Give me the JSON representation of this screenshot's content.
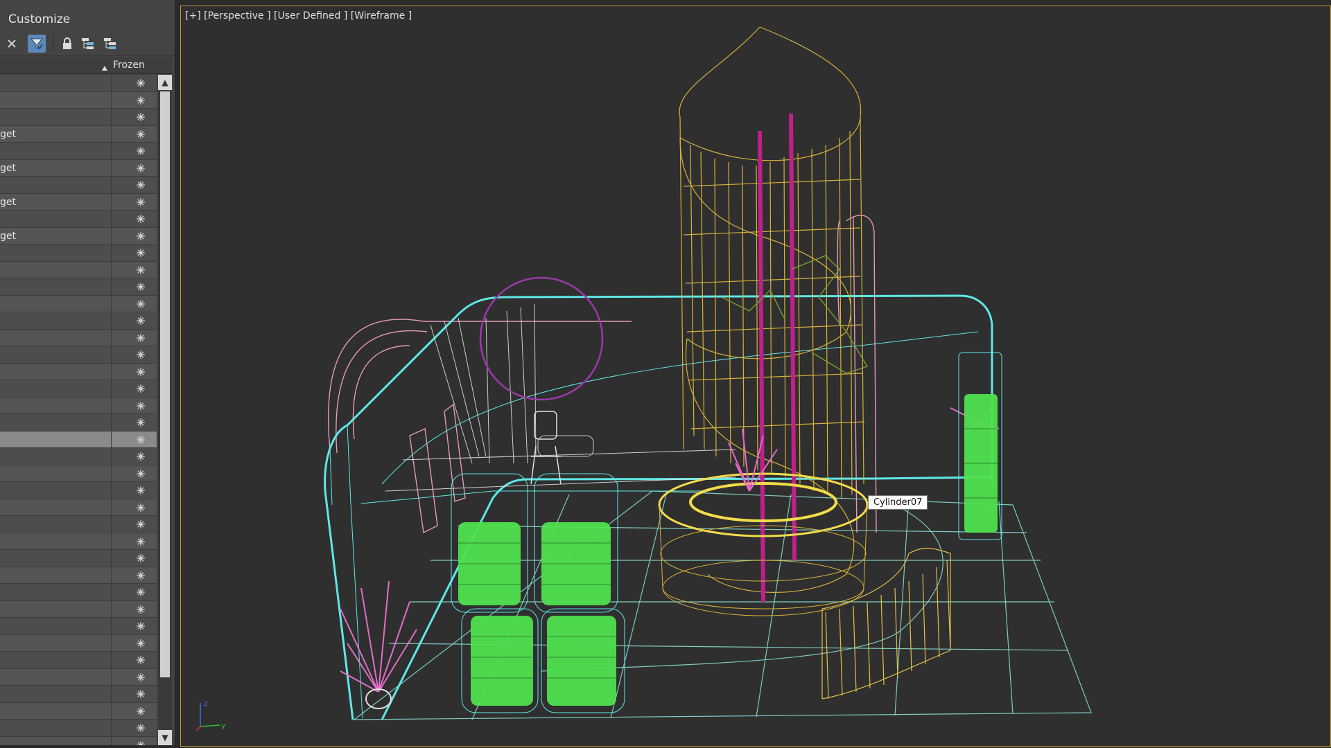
{
  "menu": {
    "label": "Customize"
  },
  "toolbar": {
    "buttons": [
      {
        "icon": "close-icon"
      },
      {
        "icon": "filter-icon",
        "active": true
      },
      {
        "icon": "lock-icon"
      },
      {
        "icon": "hierarchy-icon"
      },
      {
        "icon": "hierarchy-select-icon"
      }
    ]
  },
  "column_header": {
    "frozen_label": "Frozen",
    "sort_icon": "sort-up-icon"
  },
  "rows": [
    {
      "name": ""
    },
    {
      "name": ""
    },
    {
      "name": ""
    },
    {
      "name": "get"
    },
    {
      "name": ""
    },
    {
      "name": "get"
    },
    {
      "name": ""
    },
    {
      "name": "get"
    },
    {
      "name": ""
    },
    {
      "name": "get"
    },
    {
      "name": ""
    },
    {
      "name": ""
    },
    {
      "name": ""
    },
    {
      "name": ""
    },
    {
      "name": ""
    },
    {
      "name": ""
    },
    {
      "name": ""
    },
    {
      "name": ""
    },
    {
      "name": ""
    },
    {
      "name": ""
    },
    {
      "name": ""
    },
    {
      "name": "",
      "selected": true
    },
    {
      "name": ""
    },
    {
      "name": ""
    },
    {
      "name": ""
    },
    {
      "name": ""
    },
    {
      "name": ""
    },
    {
      "name": ""
    },
    {
      "name": ""
    },
    {
      "name": ""
    },
    {
      "name": ""
    },
    {
      "name": ""
    },
    {
      "name": ""
    },
    {
      "name": ""
    },
    {
      "name": ""
    },
    {
      "name": ""
    },
    {
      "name": ""
    },
    {
      "name": ""
    },
    {
      "name": ""
    },
    {
      "name": ""
    },
    {
      "name": ""
    }
  ],
  "viewport": {
    "label": "[+] [Perspective ] [User Defined ] [Wireframe ]",
    "tooltip": "Cylinder07",
    "gizmo_axes": "xyz-axis-icon"
  },
  "colors": {
    "accent_border": "#bf9a3a",
    "cyan": "#5fe8e8",
    "yellow": "#e2c04a",
    "pink": "#e070c8",
    "green": "#4fe04f",
    "magenta": "#c0208a",
    "purple": "#9a3aa8",
    "olive": "#7aa030",
    "white": "#d8d8d8"
  }
}
